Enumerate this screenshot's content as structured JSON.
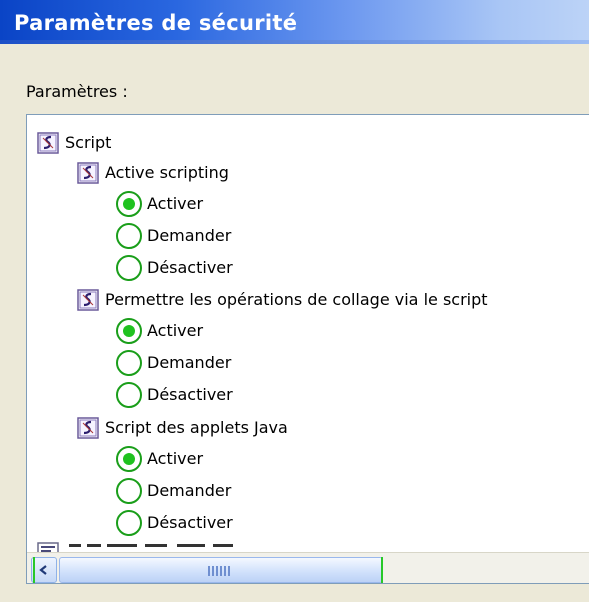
{
  "window": {
    "title": "Paramètres de sécurité"
  },
  "settings_label": "Paramètres :",
  "tree": {
    "root": {
      "label": "Script",
      "icon": "script-icon"
    },
    "groups": [
      {
        "label": "Active scripting",
        "icon": "script-icon",
        "options": [
          {
            "label": "Activer",
            "selected": true
          },
          {
            "label": "Demander",
            "selected": false
          },
          {
            "label": "Désactiver",
            "selected": false
          }
        ]
      },
      {
        "label": "Permettre les opérations de collage via le script",
        "icon": "script-icon",
        "options": [
          {
            "label": "Activer",
            "selected": true
          },
          {
            "label": "Demander",
            "selected": false
          },
          {
            "label": "Désactiver",
            "selected": false
          }
        ]
      },
      {
        "label": "Script des applets Java",
        "icon": "script-icon",
        "options": [
          {
            "label": "Activer",
            "selected": true
          },
          {
            "label": "Demander",
            "selected": false
          },
          {
            "label": "Désactiver",
            "selected": false
          }
        ]
      }
    ]
  },
  "colors": {
    "selected_radio": "#1fc21f",
    "radio_outline": "#1a9e1a",
    "title_text": "#ffffff"
  }
}
